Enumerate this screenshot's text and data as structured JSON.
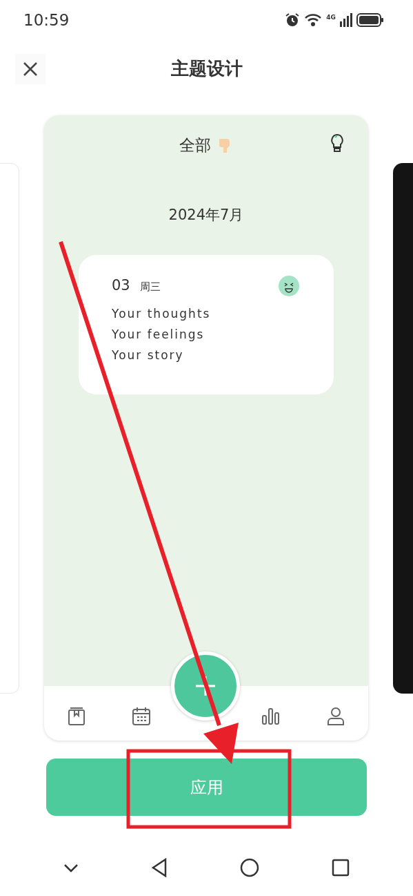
{
  "status_bar": {
    "time": "10:59",
    "network": "4G"
  },
  "header": {
    "title": "主题设计"
  },
  "preview": {
    "filter": "全部",
    "month": "2024年7月",
    "entry": {
      "day": "03",
      "weekday": "周三",
      "lines": [
        "Your thoughts",
        "Your feelings",
        "Your story"
      ]
    },
    "tab_bar": {
      "items": [
        {
          "kind": "book"
        },
        {
          "kind": "calendar"
        },
        {
          "kind": "add"
        },
        {
          "kind": "chart"
        },
        {
          "kind": "profile"
        }
      ]
    }
  },
  "apply_button": {
    "label": "应用"
  },
  "annotations": {
    "arrow": true,
    "frame": true
  },
  "nav_bar": {
    "items": [
      {
        "kind": "hide"
      },
      {
        "kind": "back"
      },
      {
        "kind": "home"
      },
      {
        "kind": "recents"
      }
    ]
  }
}
